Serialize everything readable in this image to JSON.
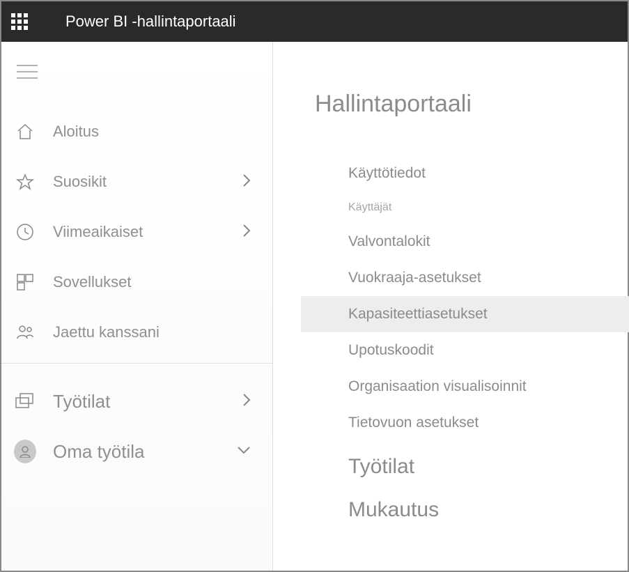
{
  "header": {
    "title": "Power BI -hallintaportaali"
  },
  "sidebar": {
    "items": [
      {
        "label": "Aloitus"
      },
      {
        "label": "Suosikit"
      },
      {
        "label": "Viimeaikaiset"
      },
      {
        "label": "Sovellukset"
      },
      {
        "label": "Jaettu kanssani"
      },
      {
        "label": "Työtilat"
      },
      {
        "label": "Oma työtila"
      }
    ]
  },
  "main": {
    "title": "Hallintaportaali",
    "items": [
      {
        "label": "Käyttötiedot"
      },
      {
        "label": "Käyttäjät"
      },
      {
        "label": "Valvontalokit"
      },
      {
        "label": "Vuokraaja-asetukset"
      },
      {
        "label": "Kapasiteettiasetukset"
      },
      {
        "label": "Upotuskoodit"
      },
      {
        "label": "Organisaation visualisoinnit"
      },
      {
        "label": "Tietovuon asetukset"
      },
      {
        "label": "Työtilat"
      },
      {
        "label": "Mukautus"
      }
    ]
  }
}
